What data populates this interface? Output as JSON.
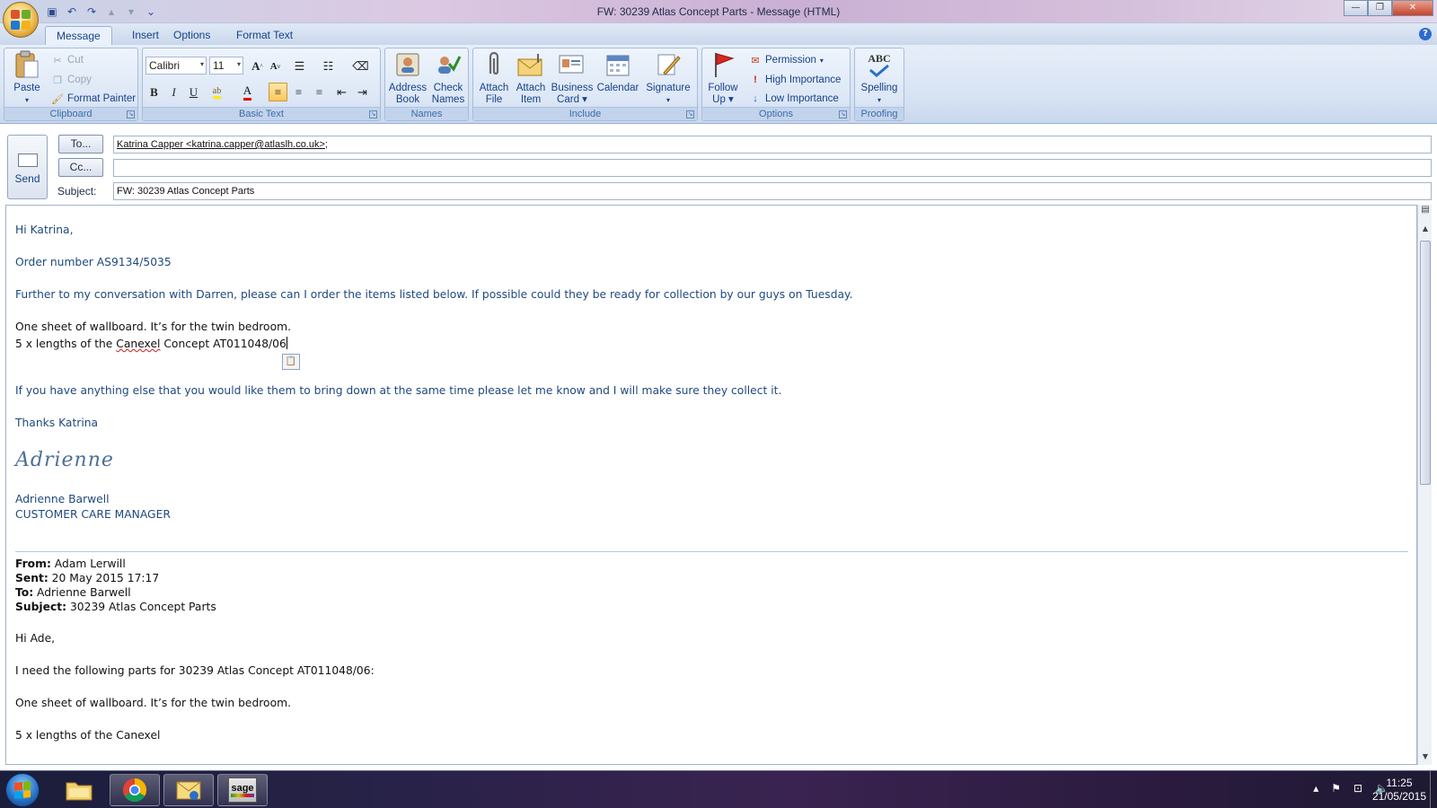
{
  "window": {
    "title": "FW: 30239 Atlas Concept Parts - Message (HTML)",
    "controls": {
      "minimize": "—",
      "restore": "❐",
      "close": "✕"
    }
  },
  "ribbon_tabs": [
    "Message",
    "Insert",
    "Options",
    "Format Text"
  ],
  "ribbon": {
    "clipboard": {
      "label": "Clipboard",
      "paste": "Paste",
      "cut": "Cut",
      "copy": "Copy",
      "format_painter": "Format Painter"
    },
    "basic_text": {
      "label": "Basic Text",
      "font": "Calibri",
      "size": "11"
    },
    "names": {
      "label": "Names",
      "address_book": [
        "Address",
        "Book"
      ],
      "check_names": [
        "Check",
        "Names"
      ]
    },
    "include": {
      "label": "Include",
      "attach_file": [
        "Attach",
        "File"
      ],
      "attach_item": [
        "Attach",
        "Item"
      ],
      "business_card": [
        "Business",
        "Card"
      ],
      "calendar": "Calendar",
      "signature": "Signature"
    },
    "options": {
      "label": "Options",
      "follow_up": [
        "Follow",
        "Up"
      ],
      "permission": "Permission",
      "high_importance": "High Importance",
      "low_importance": "Low Importance"
    },
    "proofing": {
      "label": "Proofing",
      "spelling": "Spelling",
      "abc": "ABC"
    }
  },
  "header": {
    "send": "Send",
    "to_button": "To...",
    "cc_button": "Cc...",
    "subject_label": "Subject:",
    "to_value": "Katrina Capper <katrina.capper@atlaslh.co.uk>",
    "to_sep": ";",
    "cc_value": "",
    "subject_value": "FW: 30239 Atlas Concept Parts"
  },
  "body": {
    "greeting": "Hi Katrina,",
    "order": "Order number AS9134/5035",
    "further": "Further to my conversation with Darren, please can I order the items listed below.  If possible could they be ready for collection by our guys on Tuesday.",
    "line1": "One sheet of wallboard.  It’s for the twin bedroom.",
    "line2_pre": "5 x lengths of the ",
    "line2_word": "Canexel",
    "line2_post": "  Concept AT011048/06",
    "anything": "If you have anything else that you would like them to bring down at the same time please let me know and I will make sure they collect it.",
    "thanks": "Thanks Katrina",
    "signature_script": "Adrienne",
    "sig_name": "Adrienne Barwell",
    "sig_title": "CUSTOMER CARE MANAGER",
    "from_label": "From:",
    "from_value": "Adam Lerwill",
    "sent_label": "Sent:",
    "sent_value": "20 May 2015 17:17",
    "to_label": "To:",
    "to_value": "Adrienne Barwell",
    "subj_label": "Subject:",
    "subj_value": "30239 Atlas Concept Parts",
    "hi_ade": "Hi Ade,",
    "need": "I need the following parts for 30239 Atlas Concept AT011048/06:",
    "orig1": "One sheet of wallboard.  It’s for the twin bedroom.",
    "orig2": "5 x lengths of the Canexel"
  },
  "taskbar": {
    "time": "11:25",
    "date": "21/05/2015",
    "apps": [
      "explorer-icon",
      "chrome-icon",
      "outlook-icon",
      "sage-icon"
    ],
    "sage_text": "sage"
  }
}
